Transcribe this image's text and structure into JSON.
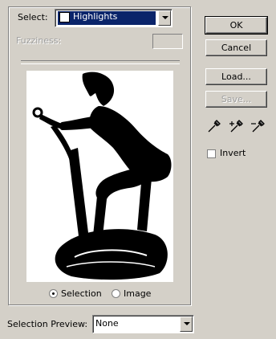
{
  "select": {
    "label": "Select:",
    "value": "Highlights"
  },
  "fuzziness": {
    "label": "Fuzziness:",
    "value": ""
  },
  "preview_mode": {
    "selection_label": "Selection",
    "image_label": "Image",
    "selected": "Selection"
  },
  "buttons": {
    "ok": "OK",
    "cancel": "Cancel",
    "load": "Load...",
    "save": "Save..."
  },
  "invert": {
    "label": "Invert",
    "checked": false
  },
  "selection_preview": {
    "label": "Selection Preview:",
    "value": "None"
  }
}
